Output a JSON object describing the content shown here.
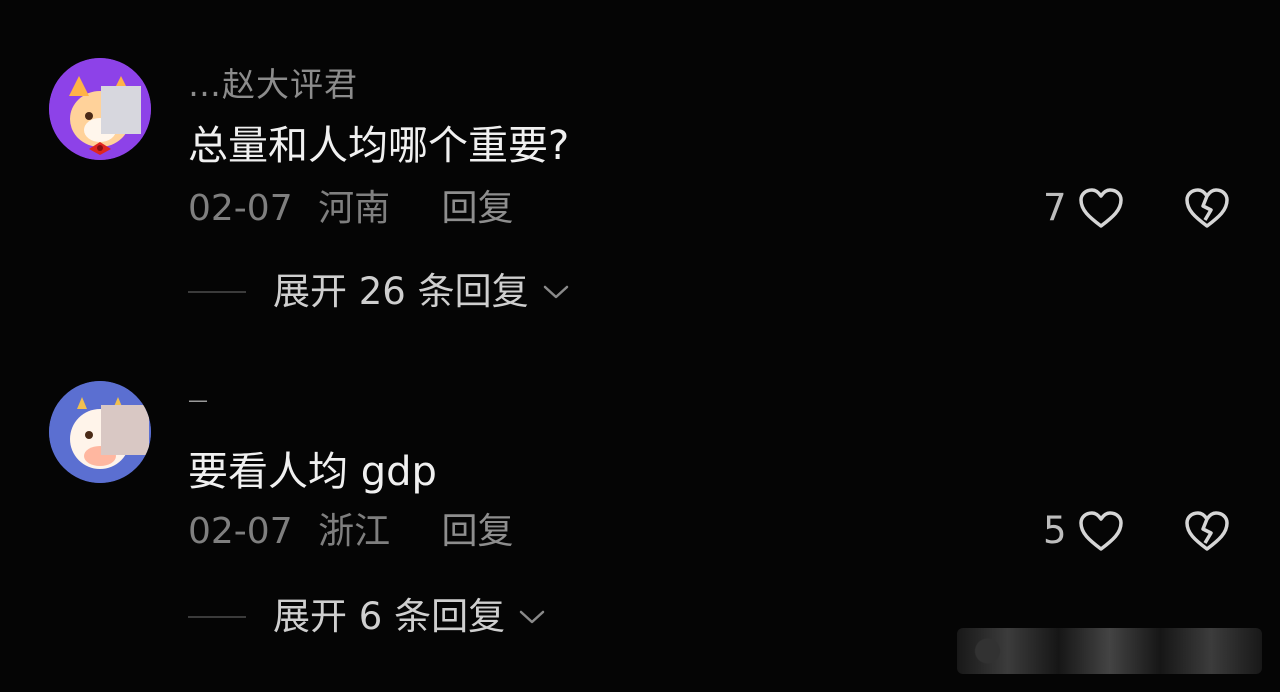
{
  "comments": [
    {
      "username": "…赵大评君",
      "content": "总量和人均哪个重要?",
      "date": "02-07",
      "region": "河南",
      "reply_label": "回复",
      "likes": "7",
      "expand_label": "展开 26 条回复"
    },
    {
      "username": "—",
      "content": "要看人均 gdp",
      "date": "02-07",
      "region": "浙江",
      "reply_label": "回复",
      "likes": "5",
      "expand_label": "展开 6 条回复"
    }
  ],
  "colors": {
    "background": "#050505",
    "primary_text": "#f0f0f0",
    "secondary_text": "#7f7f7f"
  },
  "icons": [
    "heart-icon",
    "broken-heart-icon",
    "chevron-down-icon"
  ]
}
